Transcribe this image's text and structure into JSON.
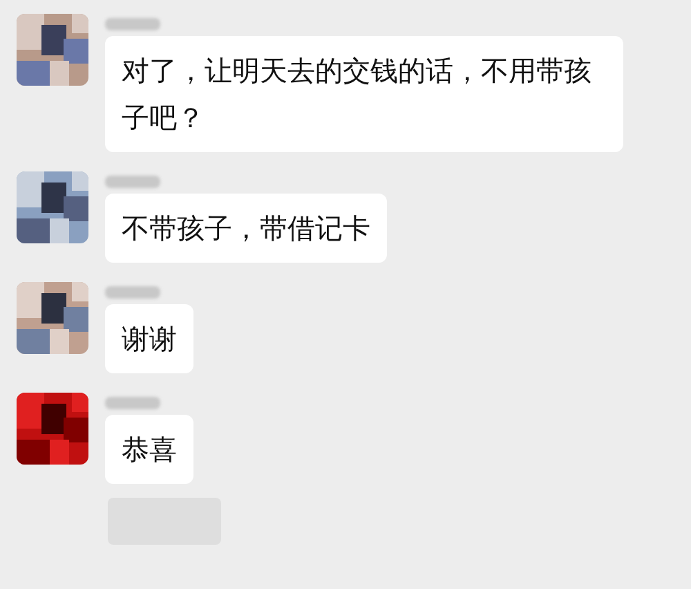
{
  "messages": [
    {
      "text": "对了，让明天去的交钱的话，不用带孩子吧？"
    },
    {
      "text": "不带孩子，带借记卡"
    },
    {
      "text": "谢谢"
    },
    {
      "text": "恭喜"
    }
  ]
}
